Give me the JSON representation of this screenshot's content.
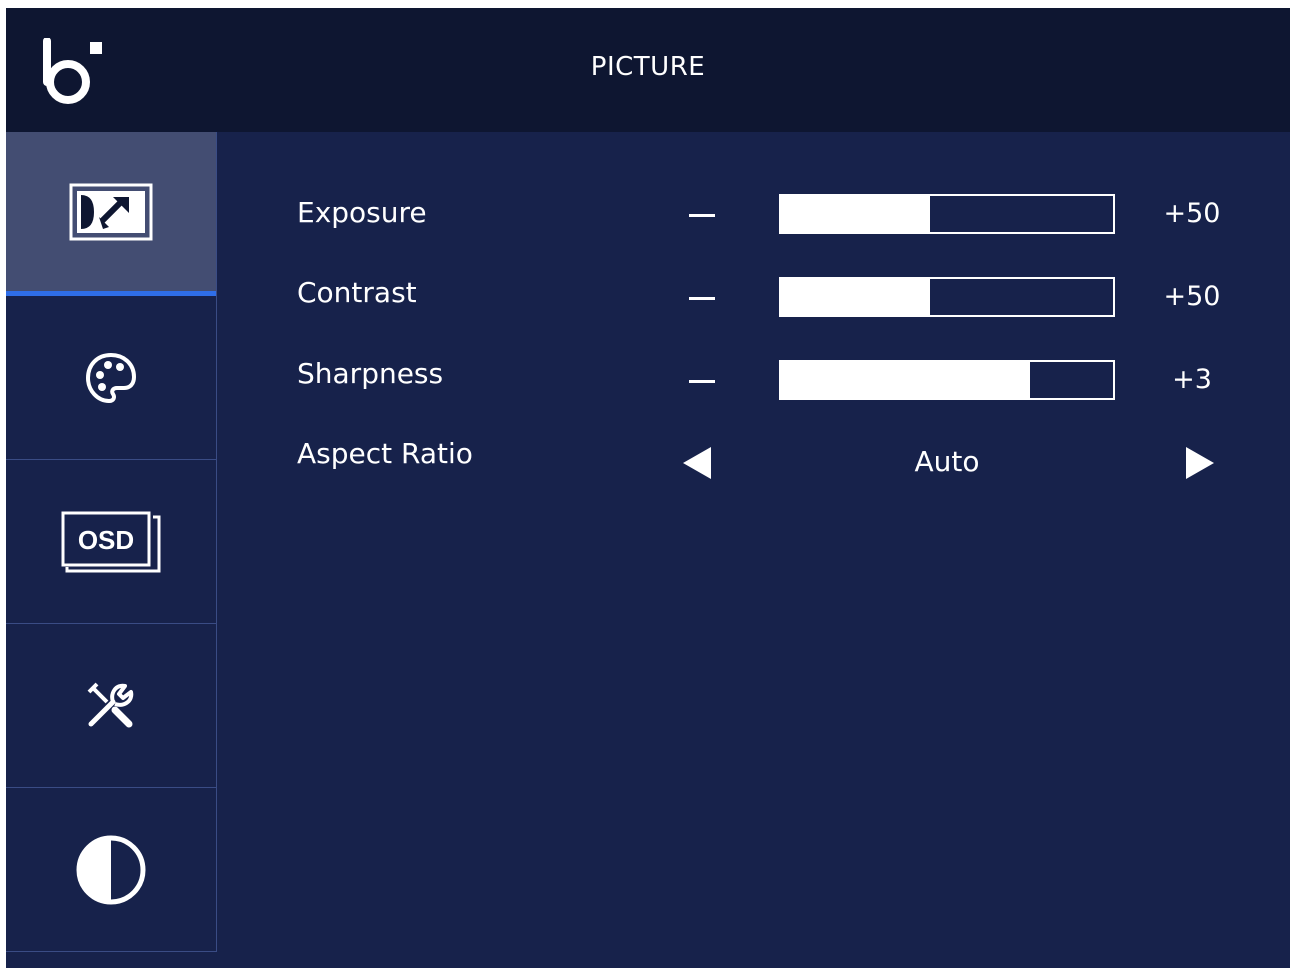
{
  "header": {
    "title": "PICTURE",
    "logo_icon": "brand-logo-icon"
  },
  "sidebar": {
    "active_color": "#434d72",
    "indicator_color": "#2f6ee8",
    "items": [
      {
        "icon": "picture-icon",
        "active": true
      },
      {
        "icon": "palette-icon",
        "active": false
      },
      {
        "icon": "osd-icon",
        "active": false
      },
      {
        "icon": "tools-icon",
        "active": false
      },
      {
        "icon": "contrast-icon",
        "active": false
      }
    ]
  },
  "settings": {
    "exposure": {
      "label": "Exposure",
      "value": "+50",
      "level_percent": 45
    },
    "contrast": {
      "label": "Contrast",
      "value": "+50",
      "level_percent": 45
    },
    "sharpness": {
      "label": "Sharpness",
      "value": "+3",
      "level_percent": 75
    },
    "aspect_ratio": {
      "label": "Aspect Ratio",
      "value": "Auto"
    }
  }
}
